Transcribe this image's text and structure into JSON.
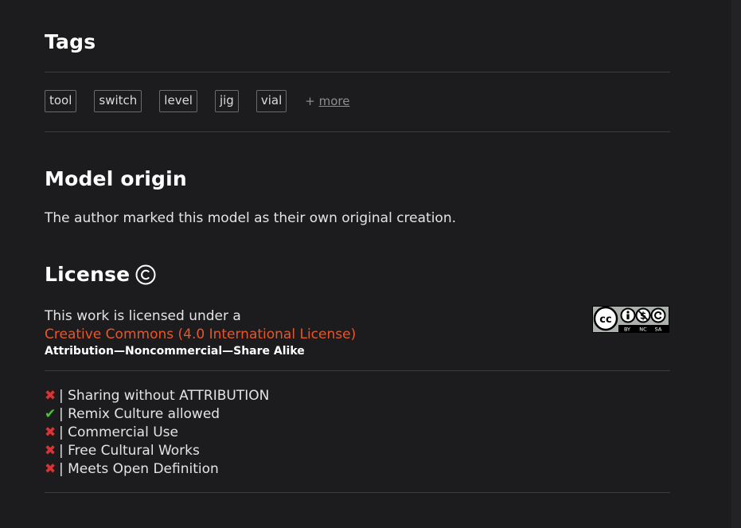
{
  "tags_section": {
    "title": "Tags",
    "tags": [
      "tool",
      "switch",
      "level",
      "jig",
      "vial"
    ],
    "more_prefix": "+ ",
    "more_label": "more"
  },
  "origin_section": {
    "title": "Model origin",
    "text": "The author marked this model as their own original creation."
  },
  "license_section": {
    "title": "License",
    "title_icon": "copyright-icon",
    "intro": "This work is licensed under a",
    "link_text": "Creative Commons (4.0 International License)",
    "terms": "Attribution—Noncommercial—Share Alike",
    "badge": {
      "icon": "cc-by-nc-sa-badge",
      "labels": [
        "BY",
        "NC",
        "SA"
      ]
    },
    "features": [
      {
        "status": "no",
        "icon": "cross-icon",
        "symbol": "✖",
        "text": "| Sharing without ATTRIBUTION"
      },
      {
        "status": "yes",
        "icon": "check-icon",
        "symbol": "✔",
        "text": "| Remix Culture allowed"
      },
      {
        "status": "no",
        "icon": "cross-icon",
        "symbol": "✖",
        "text": "| Commercial Use"
      },
      {
        "status": "no",
        "icon": "cross-icon",
        "symbol": "✖",
        "text": "| Free Cultural Works"
      },
      {
        "status": "no",
        "icon": "cross-icon",
        "symbol": "✖",
        "text": "| Meets Open Definition"
      }
    ]
  },
  "colors": {
    "background": "#1c1c1e",
    "link": "#e8562a",
    "check": "#4cc23d",
    "cross": "#d93434"
  }
}
